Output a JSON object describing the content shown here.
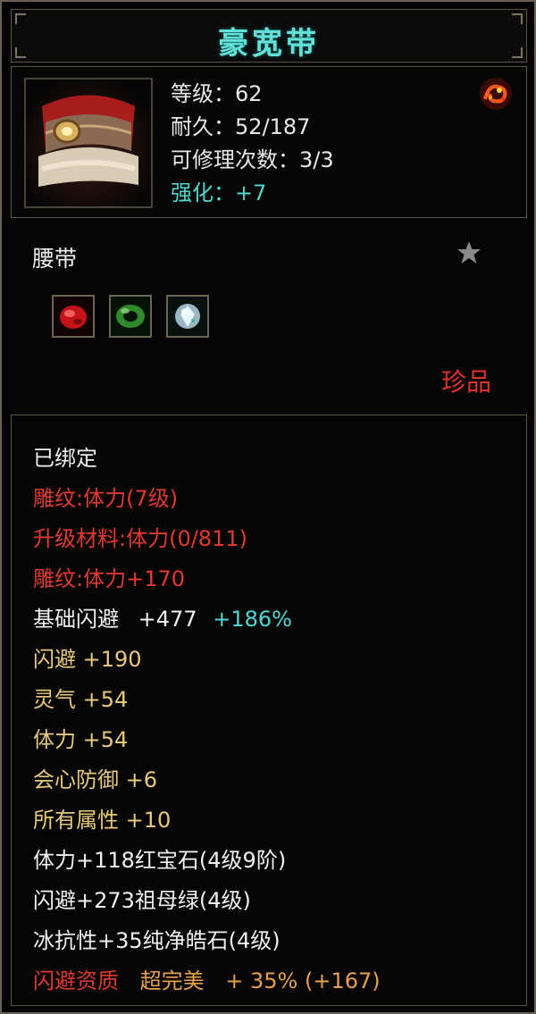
{
  "item": {
    "name": "豪宽带",
    "stats": [
      {
        "text": "等级：62",
        "color": "white"
      },
      {
        "text": "耐久：52/187",
        "color": "white"
      },
      {
        "text": "可修理次数：3/3",
        "color": "white"
      },
      {
        "text": "强化：+7",
        "color": "cyan"
      }
    ],
    "category": "腰带",
    "rarity": "珍品",
    "icons": {
      "portrait": "belt-icon",
      "badge": "dragon-badge-icon",
      "star": "star-icon",
      "gems": [
        "ruby-gem-icon",
        "emerald-gem-icon",
        "diamond-gem-icon"
      ]
    }
  },
  "attributes": {
    "bound": "已绑定",
    "engrave": "雕纹:体力(7级)",
    "upgrade_material": "升级材料:体力(0/811)",
    "engrave_bonus": "雕纹:体力+170",
    "base_dodge_label": "基础闪避",
    "base_dodge_value": "+477",
    "base_dodge_pct": "+186%",
    "dodge": "闪避  +190",
    "spirit": "灵气  +54",
    "stamina": "体力  +54",
    "crit_def": "会心防御  +6",
    "all_attr": "所有属性  +10",
    "gem1": "体力+118红宝石(4级9阶)",
    "gem2": "闪避+273祖母绿(4级)",
    "gem3": "冰抗性+35纯净皓石(4级)",
    "quality_label": "闪避资质",
    "quality_grade": "超完美",
    "quality_value": "+ 35% (+167)"
  },
  "colors": {
    "title": "#63e0d8",
    "enhance": "#4ed8d0",
    "red": "#e03a30",
    "gold": "#e8c87a",
    "rarity": "#e2322a"
  }
}
